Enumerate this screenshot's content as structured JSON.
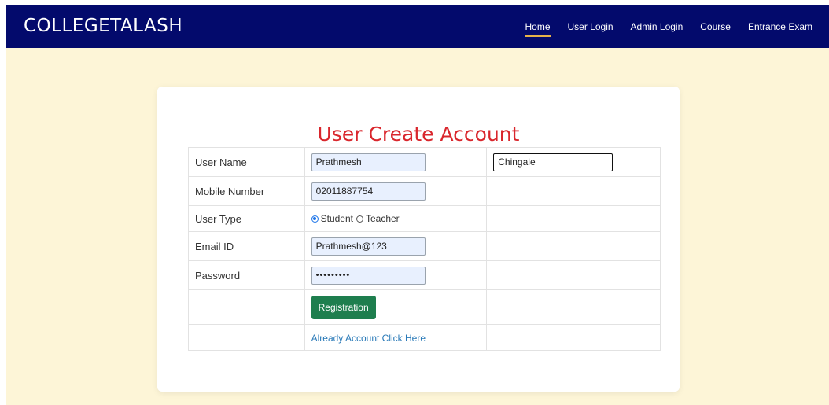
{
  "navbar": {
    "brand": "COLLEGETALASH",
    "links": [
      "Home",
      "User Login",
      "Admin Login",
      "Course",
      "Entrance Exam"
    ],
    "active": "Home"
  },
  "form": {
    "title": "User Create Account",
    "user_name_label": "User Name",
    "first_name_value": "Prathmesh",
    "last_name_value": "Chingale",
    "mobile_label": "Mobile Number",
    "mobile_value": "02011887754",
    "user_type_label": "User Type",
    "user_type_options": [
      "Student",
      "Teacher"
    ],
    "user_type_selected": "Student",
    "email_label": "Email ID",
    "email_value": "Prathmesh@123",
    "password_label": "Password",
    "password_value": "•••••••••",
    "register_button": "Registration",
    "login_link": "Already Account Click Here"
  },
  "colors": {
    "navbar_bg": "#030a6c",
    "page_bg": "#fdf5d7",
    "title": "#d9262c",
    "button": "#1e7e4e",
    "link": "#2a7ab8"
  }
}
